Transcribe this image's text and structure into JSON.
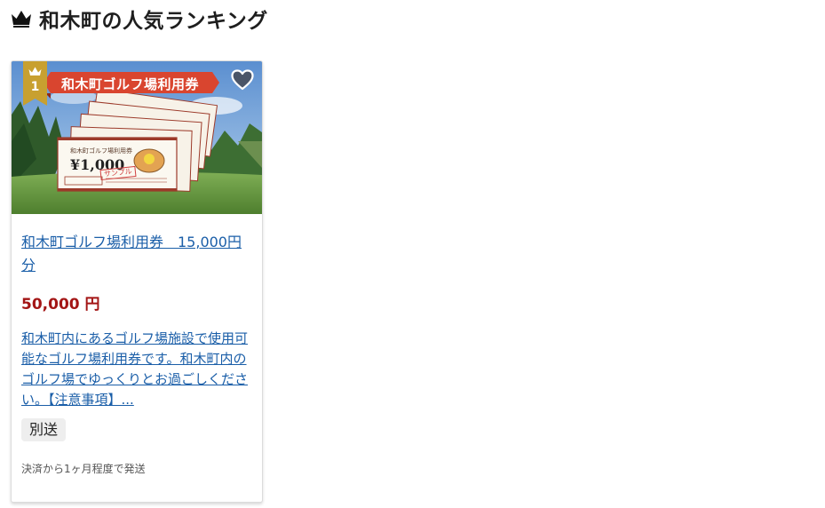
{
  "header": {
    "title": "和木町の人気ランキング",
    "icon": "crown-icon"
  },
  "colors": {
    "accent_gold": "#c8a030",
    "link_blue": "#1a5ea8",
    "price_red": "#a31515",
    "banner_red": "#d9452f"
  },
  "ranking": {
    "items": [
      {
        "rank": "1",
        "image": {
          "banner_text": "和木町ゴルフ場利用券",
          "ticket_title": "和木町ゴルフ場利用券",
          "ticket_price": "¥1,000",
          "sample_mark": "サンプル"
        },
        "name": "和木町ゴルフ場利用券　15,000円分",
        "price": "50,000 円",
        "description": "和木町内にあるゴルフ場施設で使用可能なゴルフ場利用券です。和木町内のゴルフ場でゆっくりとお過ごしください。【注意事項】...",
        "tag": "別送",
        "shipping_note": "決済から1ヶ月程度で発送",
        "favorite_icon": "heart-icon"
      }
    ]
  }
}
